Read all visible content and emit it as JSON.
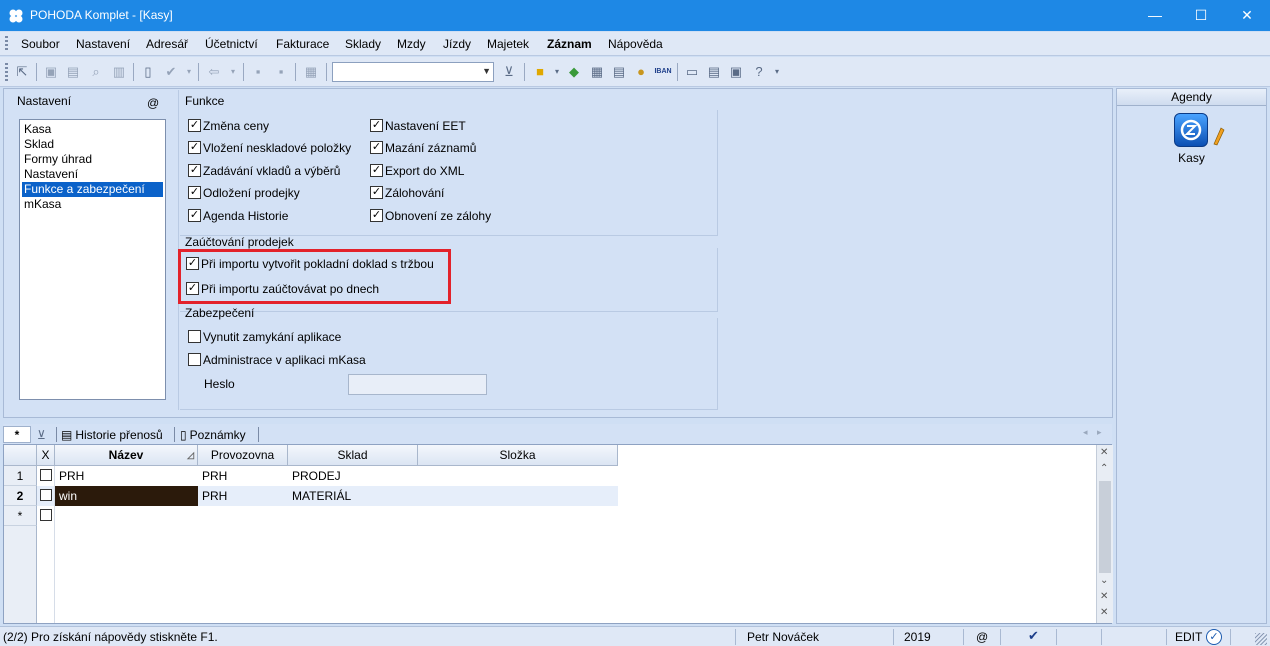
{
  "window": {
    "title": "POHODA Komplet - [Kasy]",
    "minimize": "—",
    "maximize": "☐",
    "close": "✕"
  },
  "menu": [
    "Soubor",
    "Nastavení",
    "Adresář",
    "Účetnictví",
    "Fakturace",
    "Sklady",
    "Mzdy",
    "Jízdy",
    "Majetek",
    "Záznam",
    "Nápověda"
  ],
  "toolbar": {
    "combo_value": ""
  },
  "left_panel": {
    "title": "Nastavení",
    "at": "@",
    "items": [
      "Kasa",
      "Sklad",
      "Formy úhrad",
      "Nastavení",
      "Funkce a zabezpečení",
      "mKasa"
    ],
    "selected_index": 4
  },
  "funkce": {
    "title": "Funkce",
    "col1": [
      {
        "label": "Změna ceny",
        "checked": true
      },
      {
        "label": "Vložení neskladové položky",
        "checked": true
      },
      {
        "label": "Zadávání vkladů a výběrů",
        "checked": true
      },
      {
        "label": "Odložení prodejky",
        "checked": true
      },
      {
        "label": "Agenda Historie",
        "checked": true
      }
    ],
    "col2": [
      {
        "label": "Nastavení EET",
        "checked": true
      },
      {
        "label": "Mazání záznamů",
        "checked": true
      },
      {
        "label": "Export do XML",
        "checked": true
      },
      {
        "label": "Zálohování",
        "checked": true
      },
      {
        "label": "Obnovení ze zálohy",
        "checked": true
      }
    ]
  },
  "zauctovani": {
    "title": "Zaúčtování prodejek",
    "items": [
      {
        "label": "Při importu vytvořit pokladní doklad s tržbou",
        "checked": true
      },
      {
        "label": "Při importu zaúčtovávat po dnech",
        "checked": true
      }
    ]
  },
  "zabezpeceni": {
    "title": "Zabezpečení",
    "items": [
      {
        "label": "Vynutit zamykání aplikace",
        "checked": false
      },
      {
        "label": "Administrace v aplikaci mKasa",
        "checked": false
      }
    ],
    "heslo_label": "Heslo",
    "heslo_value": ""
  },
  "agendy": {
    "title": "Agendy",
    "items": [
      {
        "label": "Kasy"
      }
    ]
  },
  "tabs": {
    "star": "*",
    "historie": "Historie přenosů",
    "poznamky": "Poznámky"
  },
  "grid": {
    "columns": [
      "X",
      "Název",
      "Provozovna",
      "Sklad",
      "Složka"
    ],
    "rows": [
      {
        "num": "1",
        "nazev": "PRH",
        "provozovna": "PRH",
        "sklad": "PRODEJ",
        "slozka": ""
      },
      {
        "num": "2",
        "nazev": "win",
        "provozovna": "PRH",
        "sklad": "MATERIÁL",
        "slozka": ""
      }
    ],
    "new_row": "*"
  },
  "status": {
    "help": "(2/2) Pro získání nápovědy stiskněte F1.",
    "user": "Petr Nováček",
    "year": "2019",
    "at": "@",
    "mode": "EDIT"
  }
}
